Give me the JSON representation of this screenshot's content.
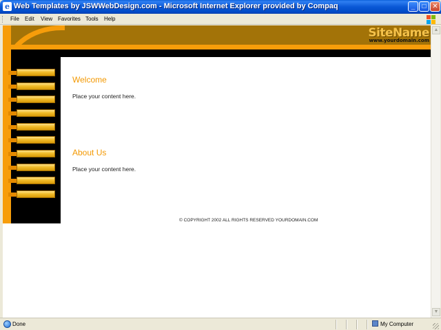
{
  "window": {
    "title": "Web Templates by JSWWebDesign.com - Microsoft Internet Explorer provided by Compaq",
    "controls": {
      "minimize": "_",
      "maximize": "□",
      "close": "✕"
    }
  },
  "menu": {
    "items": [
      {
        "label": "File"
      },
      {
        "label": "Edit"
      },
      {
        "label": "View"
      },
      {
        "label": "Favorites"
      },
      {
        "label": "Tools"
      },
      {
        "label": "Help"
      }
    ]
  },
  "site": {
    "name": "SiteName",
    "domain": "www.yourdomain.com",
    "colors": {
      "header": "#a37308",
      "accent": "#f79d0a",
      "nav_gold": "#f2bc2a",
      "title": "#f39800"
    },
    "nav_button_count": 10,
    "sections": [
      {
        "title": "Welcome",
        "body": "Place your content here."
      },
      {
        "title": "About Us",
        "body": "Place your content here."
      }
    ],
    "copyright": "© COPYRIGHT 2002 ALL RIGHTS RESERVED YOURDOMAIN.COM"
  },
  "statusbar": {
    "status": "Done",
    "zone": "My Computer"
  }
}
